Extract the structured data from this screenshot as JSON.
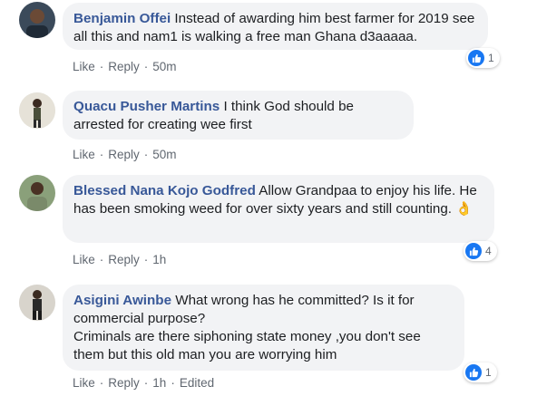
{
  "comments": [
    {
      "author": "Benjamin Offei",
      "text": "Instead of awarding him best farmer for 2019 see all this and nam1 is walking a free man Ghana d3aaaaa.",
      "emoji": "",
      "actions": {
        "like": "Like",
        "reply": "Reply",
        "time": "50m",
        "edited": ""
      },
      "reaction_count": "1"
    },
    {
      "author": "Quacu Pusher Martins",
      "text": "I think God should be arrested for creating wee first",
      "emoji": "",
      "actions": {
        "like": "Like",
        "reply": "Reply",
        "time": "50m",
        "edited": ""
      },
      "reaction_count": ""
    },
    {
      "author": "Blessed Nana Kojo Godfred",
      "text": "Allow Grandpaa to enjoy his life. He has been smoking weed for over sixty years and still counting.",
      "emoji": "👌",
      "actions": {
        "like": "Like",
        "reply": "Reply",
        "time": "1h",
        "edited": ""
      },
      "reaction_count": "4"
    },
    {
      "author": "Asigini Awinbe",
      "text": "What wrong has he committed? Is it for commercial purpose?\nCriminals are there siphoning state money ,you don't see them but this old man you are worrying him",
      "emoji": "",
      "actions": {
        "like": "Like",
        "reply": "Reply",
        "time": "1h",
        "edited": "Edited"
      },
      "reaction_count": "1"
    }
  ],
  "separator": "·",
  "colors": {
    "author": "#385898",
    "bubble": "#f2f3f5",
    "like": "#1877f2",
    "meta": "#606770"
  },
  "icons": {
    "reaction": "thumbs-up-icon"
  }
}
